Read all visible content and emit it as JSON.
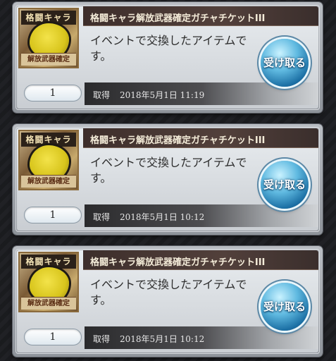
{
  "items": [
    {
      "title": "格闘キャラ解放武器確定ガチャチケットIII",
      "description": "イベントで交換したアイテムです。",
      "icon_head": "格闘キャラ",
      "icon_foot": "解放武器確定",
      "quantity": "1",
      "acquired_label": "取得",
      "acquired_date": "2018年5月1日 11:19",
      "receive_label": "受け取る"
    },
    {
      "title": "格闘キャラ解放武器確定ガチャチケットIII",
      "description": "イベントで交換したアイテムです。",
      "icon_head": "格闘キャラ",
      "icon_foot": "解放武器確定",
      "quantity": "1",
      "acquired_label": "取得",
      "acquired_date": "2018年5月1日 10:12",
      "receive_label": "受け取る"
    },
    {
      "title": "格闘キャラ解放武器確定ガチャチケットIII",
      "description": "イベントで交換したアイテムです。",
      "icon_head": "格闘キャラ",
      "icon_foot": "解放武器確定",
      "quantity": "1",
      "acquired_label": "取得",
      "acquired_date": "2018年5月1日 10:12",
      "receive_label": "受け取る"
    }
  ]
}
